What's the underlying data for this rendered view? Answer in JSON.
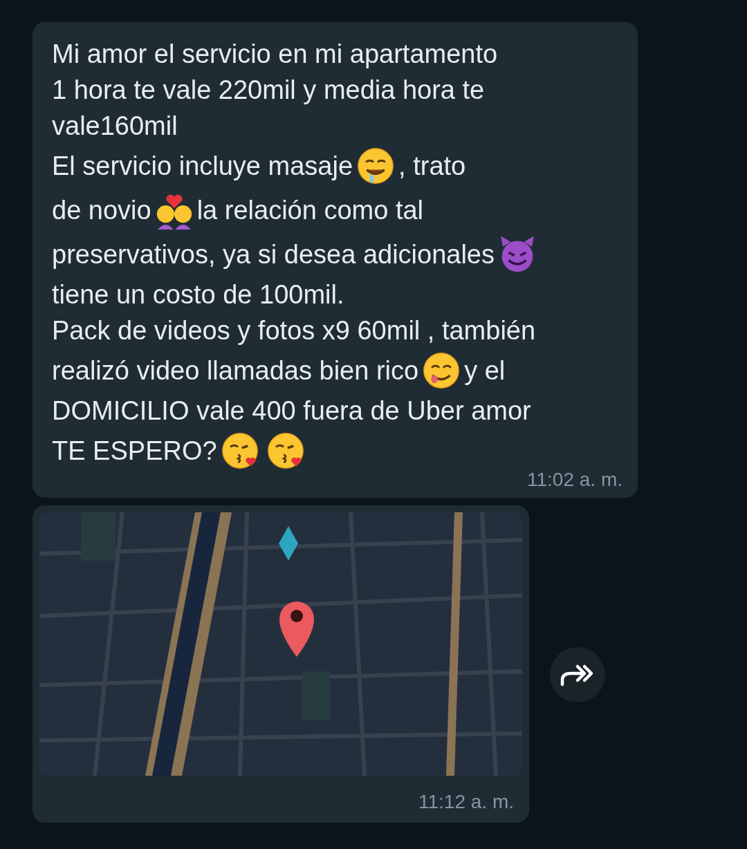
{
  "messages": [
    {
      "kind": "text",
      "lines": [
        [
          {
            "kind": "text",
            "text": "Mi amor el servicio en mi apartamento"
          }
        ],
        [
          {
            "kind": "text",
            "text": "1 hora te vale 220mil y media hora te"
          }
        ],
        [
          {
            "kind": "text",
            "text": "vale160mil"
          }
        ],
        [
          {
            "kind": "text",
            "text": "El servicio incluye masaje"
          },
          {
            "kind": "drool"
          },
          {
            "kind": "text",
            "text": ", trato"
          }
        ],
        [
          {
            "kind": "text",
            "text": "de novio"
          },
          {
            "kind": "couple"
          },
          {
            "kind": "text",
            "text": "la relación como tal"
          }
        ],
        [
          {
            "kind": "text",
            "text": "preservativos, ya si desea adicionales"
          },
          {
            "kind": "devil"
          }
        ],
        [
          {
            "kind": "text",
            "text": "tiene un costo de 100mil."
          }
        ],
        [
          {
            "kind": "text",
            "text": "Pack de videos y fotos x9 60mil , también"
          }
        ],
        [
          {
            "kind": "text",
            "text": "realizó video llamadas bien rico"
          },
          {
            "kind": "yum"
          },
          {
            "kind": "text",
            "text": "y el"
          }
        ],
        [
          {
            "kind": "text",
            "text": "DOMICILIO vale 400 fuera de Uber amor"
          }
        ],
        [
          {
            "kind": "text",
            "text": "TE ESPERO?"
          },
          {
            "kind": "kiss"
          },
          {
            "kind": "kiss"
          }
        ]
      ],
      "time": "11:02 a. m."
    },
    {
      "kind": "location",
      "time": "11:12 a. m."
    }
  ]
}
